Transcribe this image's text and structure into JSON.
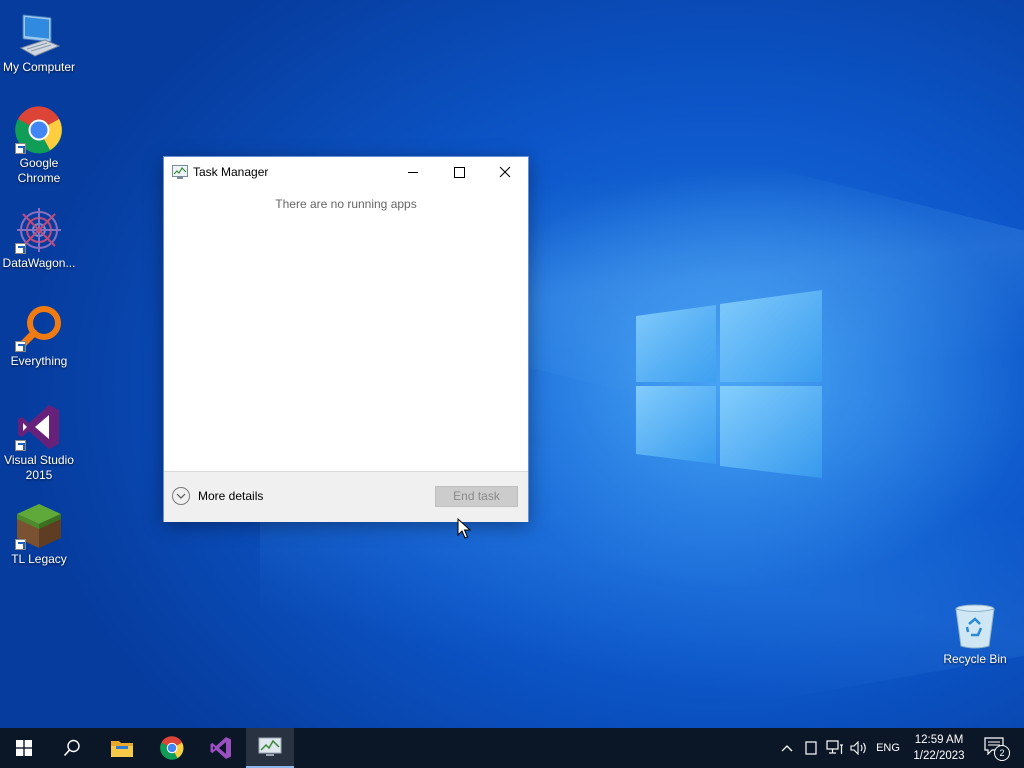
{
  "desktop": {
    "icons": [
      {
        "label": "My Computer",
        "icon": "monitor-icon"
      },
      {
        "label": "Google Chrome",
        "icon": "chrome-icon"
      },
      {
        "label": "DataWagon...",
        "icon": "datawagon-icon"
      },
      {
        "label": "Everything",
        "icon": "everything-search-icon"
      },
      {
        "label": "Visual Studio 2015",
        "icon": "visual-studio-icon"
      },
      {
        "label": "TL Legacy",
        "icon": "grass-block-icon"
      },
      {
        "label": "Recycle Bin",
        "icon": "recycle-bin-icon"
      }
    ]
  },
  "task_manager": {
    "title": "Task Manager",
    "empty_message": "There are no running apps",
    "more_details_label": "More details",
    "end_task_label": "End task",
    "end_task_enabled": false
  },
  "taskbar": {
    "pinned": [
      {
        "name": "start",
        "icon": "windows-start-icon"
      },
      {
        "name": "search",
        "icon": "search-icon"
      },
      {
        "name": "file-explorer",
        "icon": "folder-icon"
      },
      {
        "name": "chrome",
        "icon": "chrome-icon"
      },
      {
        "name": "visual-studio",
        "icon": "visual-studio-icon"
      },
      {
        "name": "task-manager",
        "icon": "task-manager-icon",
        "active": true
      }
    ],
    "tray": {
      "language": "ENG",
      "time": "12:59 AM",
      "date": "1/22/2023",
      "notification_count": "2"
    }
  },
  "colors": {
    "taskbar": "#0b1627",
    "desktop_blue": "#0c55c8",
    "window_border": "#6b8ed1",
    "end_task_disabled": "#cccccc"
  }
}
